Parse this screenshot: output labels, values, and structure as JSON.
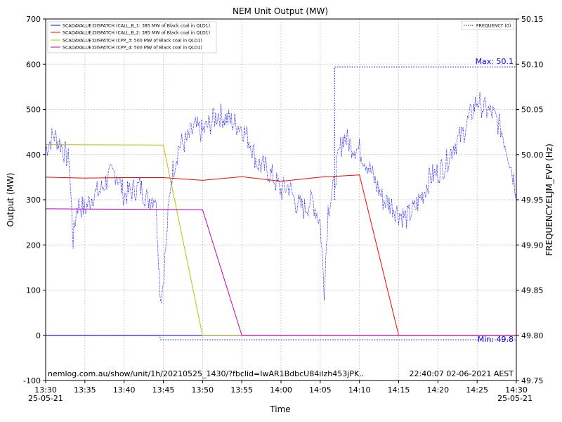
{
  "chart_data": {
    "type": "line",
    "title": "NEM Unit Output (MW)",
    "xlabel": "Time",
    "ylabel": "Output (MW)",
    "y2label": "FREQUENCY.ELJM_FVP (Hz)",
    "x_ticks": [
      "13:30",
      "13:35",
      "13:40",
      "13:45",
      "13:50",
      "13:55",
      "14:00",
      "14:05",
      "14:10",
      "14:15",
      "14:20",
      "14:25",
      "14:30"
    ],
    "x_date_left": "25-05-21",
    "x_date_right": "25-05-21",
    "ylim": [
      -100,
      700
    ],
    "y_ticks": [
      -100,
      0,
      100,
      200,
      300,
      400,
      500,
      600,
      700
    ],
    "y2lim": [
      49.75,
      50.15
    ],
    "y2_ticks": [
      "49.75",
      "49.80",
      "49.85",
      "49.90",
      "49.95",
      "50.00",
      "50.05",
      "50.10",
      "50.15"
    ],
    "grid": true,
    "legend_left": "top-left",
    "legend_right": "top-right",
    "series": [
      {
        "name": "SCADAVALUE:DISPATCH (CALL_B_1: 385 MW of Black coal in QLD1)",
        "color": "#0000ff",
        "axis": "left",
        "x": [
          "13:30",
          "14:30"
        ],
        "values": [
          0,
          0
        ]
      },
      {
        "name": "SCADAVALUE:DISPATCH (CALL_B_2: 385 MW of Black coal in QLD1)",
        "color": "#ff0000",
        "axis": "left",
        "x": [
          "13:30",
          "13:35",
          "13:40",
          "13:45",
          "13:50",
          "13:55",
          "14:00",
          "14:05",
          "14:10",
          "14:15",
          "14:30"
        ],
        "values": [
          350,
          348,
          349,
          349,
          343,
          351,
          341,
          350,
          355,
          0,
          0
        ]
      },
      {
        "name": "SCADAVALUE:DISPATCH (CPP_3: 500 MW of Black coal in QLD1)",
        "color": "#bfbf00",
        "axis": "left",
        "x": [
          "13:30",
          "13:45",
          "13:50",
          "14:30"
        ],
        "values": [
          422,
          421,
          0,
          0
        ]
      },
      {
        "name": "SCADAVALUE:DISPATCH (CPP_4: 500 MW of Black coal in QLD1)",
        "color": "#bf00bf",
        "axis": "left",
        "x": [
          "13:30",
          "13:50",
          "13:55",
          "14:30"
        ],
        "values": [
          280,
          278,
          0,
          0
        ]
      }
    ],
    "frequency_series": {
      "name": "FREQUENCY (0)",
      "color": "#0000ff",
      "axis": "right",
      "x": [
        "13:30",
        "13:31",
        "13:32",
        "13:33",
        "13:33:30",
        "13:34",
        "13:35",
        "13:36",
        "13:37",
        "13:38",
        "13:39",
        "13:40",
        "13:41",
        "13:42",
        "13:43",
        "13:44",
        "13:44:30",
        "13:44:40",
        "13:45",
        "13:45:30",
        "13:46",
        "13:47",
        "13:48",
        "13:49",
        "13:50",
        "13:51",
        "13:52",
        "13:53",
        "13:54",
        "13:55",
        "13:56",
        "13:57",
        "13:58",
        "13:59",
        "14:00",
        "14:01",
        "14:02",
        "14:03",
        "14:04",
        "14:05",
        "14:05:30",
        "14:06",
        "14:06:30",
        "14:06:45",
        "14:07",
        "14:07:30",
        "14:08",
        "14:09",
        "14:10",
        "14:11",
        "14:12",
        "14:13",
        "14:14",
        "14:15",
        "14:16",
        "14:17",
        "14:18",
        "14:19",
        "14:20",
        "14:21",
        "14:22",
        "14:23",
        "14:24",
        "14:25",
        "14:26",
        "14:27",
        "14:28",
        "14:29",
        "14:30"
      ],
      "values": [
        50.006,
        50.022,
        50.01,
        49.992,
        49.905,
        49.945,
        49.94,
        49.955,
        49.96,
        49.975,
        49.98,
        49.955,
        49.96,
        49.965,
        49.95,
        49.955,
        49.87,
        49.84,
        49.86,
        49.92,
        49.975,
        50.01,
        50.015,
        50.03,
        50.025,
        50.035,
        50.045,
        50.04,
        50.035,
        50.03,
        50.015,
        49.99,
        49.985,
        49.975,
        49.96,
        49.965,
        49.945,
        49.94,
        49.95,
        49.925,
        49.85,
        49.94,
        49.955,
        49.965,
        49.98,
        50.005,
        50.02,
        50.01,
        50.005,
        49.99,
        49.97,
        49.95,
        49.945,
        49.935,
        49.93,
        49.94,
        49.955,
        49.975,
        49.98,
        49.99,
        50.01,
        50.02,
        50.04,
        50.06,
        50.05,
        50.045,
        50.03,
        50.0,
        49.96
      ],
      "max_label": "Max: 50.1",
      "min_label": "Min: 49.8",
      "max_line": 50.097,
      "min_line": 49.795,
      "step_time": "14:06:50"
    },
    "annotations": {
      "source": "nemlog.com.au/show/unit/1h/20210525_1430/?fbclid=IwAR1BdbcU84iIzh453jPK..",
      "timestamp": "22:40:07 02-06-2021 AEST"
    }
  }
}
